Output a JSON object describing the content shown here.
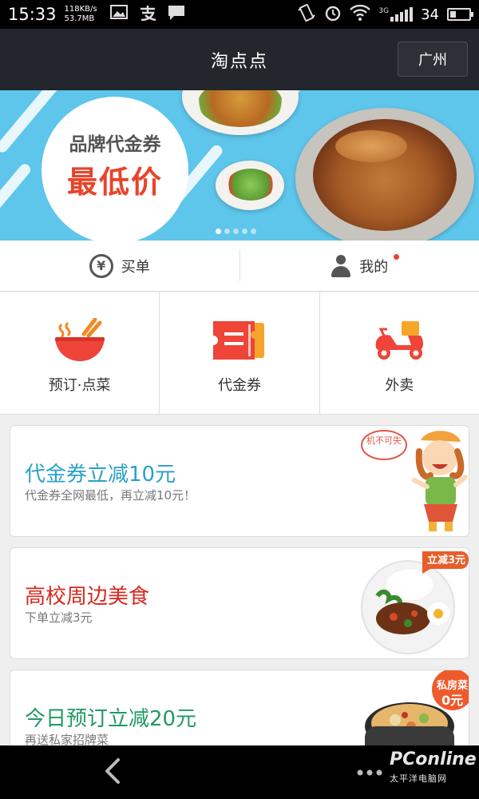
{
  "status_bar": {
    "time": "15:33",
    "net_speed": "118KB/s",
    "net_total": "53.7MB",
    "network_type": "3G",
    "battery": "34",
    "battery_level": 0.34,
    "icons": [
      "image-icon",
      "alipay-icon",
      "message-icon",
      "vibrate-icon",
      "alarm-icon",
      "wifi-icon",
      "signal-icon",
      "battery-icon"
    ]
  },
  "header": {
    "title": "淘点点",
    "city": "广州"
  },
  "banner": {
    "subtitle": "品牌代金券",
    "title": "最低价",
    "slide_count": 5,
    "active_slide": 1,
    "colors": {
      "background": "#5ec5eb",
      "title": "#e8442a"
    }
  },
  "quick_bar": {
    "pay": {
      "label": "买单",
      "icon": "yen-icon"
    },
    "mine": {
      "label": "我的",
      "icon": "person-icon",
      "has_notification": true
    }
  },
  "categories": [
    {
      "label": "预订·点菜",
      "icon": "bowl-icon"
    },
    {
      "label": "代金券",
      "icon": "voucher-icon"
    },
    {
      "label": "外卖",
      "icon": "scooter-icon"
    }
  ],
  "promos": [
    {
      "title": "代金券立减10元",
      "subtitle": "代金券全网最低，再立减10元！",
      "title_color": "#2aa1c6",
      "art": "cartoon-girl-icon",
      "bubble_text": "机不可失"
    },
    {
      "title": "高校周边美食",
      "subtitle": "下单立减3元",
      "title_color": "#d6281e",
      "art": "rice-plate-icon",
      "badge": "立减3元"
    },
    {
      "title": "今日预订立减20元",
      "subtitle": "再送私家招牌菜",
      "title_color": "#1f9a63",
      "art": "hotpot-icon",
      "badge_line1": "私房菜",
      "badge_line2": "0元"
    }
  ],
  "nav_bar": {
    "icons": [
      "back-icon",
      "more-icon"
    ]
  },
  "watermark": {
    "brand": "PConline",
    "sub": "太平洋电脑网"
  }
}
